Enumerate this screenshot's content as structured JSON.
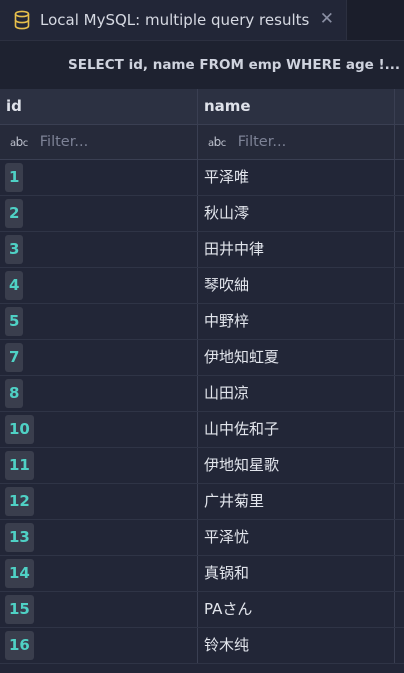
{
  "tab": {
    "title": "Local MySQL: multiple query results",
    "close": "✕",
    "icon": "database-icon"
  },
  "query": {
    "label": "SELECT id, name FROM emp WHERE age !..."
  },
  "columns": [
    "id",
    "name"
  ],
  "filters": {
    "icon_text_small": "a",
    "icon_text_big": "b",
    "icon_text_small2": "c",
    "placeholder": "Filter..."
  },
  "rows": [
    {
      "id": "1",
      "name": "平泽唯"
    },
    {
      "id": "2",
      "name": "秋山澪"
    },
    {
      "id": "3",
      "name": "田井中律"
    },
    {
      "id": "4",
      "name": "琴吹紬"
    },
    {
      "id": "5",
      "name": "中野梓"
    },
    {
      "id": "7",
      "name": "伊地知虹夏"
    },
    {
      "id": "8",
      "name": "山田凉"
    },
    {
      "id": "10",
      "name": "山中佐和子"
    },
    {
      "id": "11",
      "name": "伊地知星歌"
    },
    {
      "id": "12",
      "name": "广井菊里"
    },
    {
      "id": "13",
      "name": "平泽忧"
    },
    {
      "id": "14",
      "name": "真锅和"
    },
    {
      "id": "15",
      "name": "PAさん"
    },
    {
      "id": "16",
      "name": "铃木纯"
    }
  ],
  "colors": {
    "accent_id": "#4fd1c5",
    "background": "#222637",
    "header": "#2c3142",
    "db_icon": "#e8c04c"
  }
}
